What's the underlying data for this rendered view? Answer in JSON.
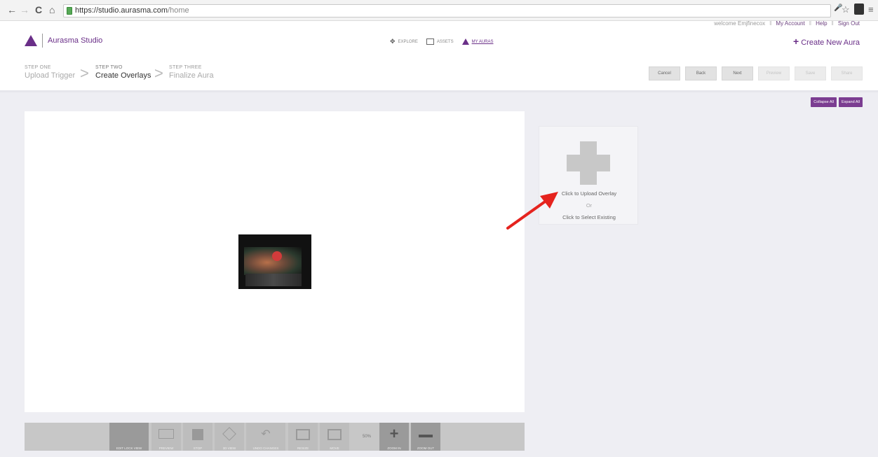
{
  "browser": {
    "url_host": "https://studio.aurasma.com",
    "url_path": "/home",
    "nav_back": "←",
    "nav_forward": "→",
    "nav_reload": "C",
    "nav_home": "⌂",
    "mic_icon": "🎤",
    "star_icon": "☆",
    "menu_icon": "≡"
  },
  "top_links": {
    "welcome": "welcome Emjfinecox",
    "sep": "‖",
    "my_account": "My Account",
    "help": "Help",
    "sign_out": "Sign Out"
  },
  "header": {
    "logo_text": "Aurasma Studio",
    "nav": {
      "explore": "EXPLORE",
      "assets": "ASSETS",
      "my_auras": "MY AURAS"
    },
    "create_new_plus": "+",
    "create_new": "Create New Aura"
  },
  "steps": [
    {
      "num": "STEP ONE",
      "name": "Upload Trigger"
    },
    {
      "num": "STEP TWO",
      "name": "Create Overlays"
    },
    {
      "num": "STEP THREE",
      "name": "Finalize Aura"
    }
  ],
  "step_buttons": {
    "cancel": "Cancel",
    "back": "Back",
    "next": "Next",
    "preview": "Preview",
    "save": "Save",
    "share": "Share"
  },
  "panel_buttons": {
    "collapse_all": "Collapse All",
    "expand_all": "Expand All"
  },
  "overlay_card": {
    "upload": "Click to Upload Overlay",
    "or": "Or",
    "select_existing": "Click to Select Existing"
  },
  "toolbar": {
    "lock_view": "EDIT LOCK VIEW",
    "preview": "PREVIEW",
    "stop": "STOP",
    "rotate_3d": "3D VIEW",
    "undo": "UNDO CHANGES",
    "resize": "RESIZE",
    "move": "MOVE",
    "zoom_level": "50%",
    "zoom_in": "ZOOM IN",
    "zoom_out": "ZOOM OUT"
  },
  "colors": {
    "brand": "#6a2f88",
    "button_purple": "#7b3d91",
    "arrow_red": "#e5231e"
  }
}
